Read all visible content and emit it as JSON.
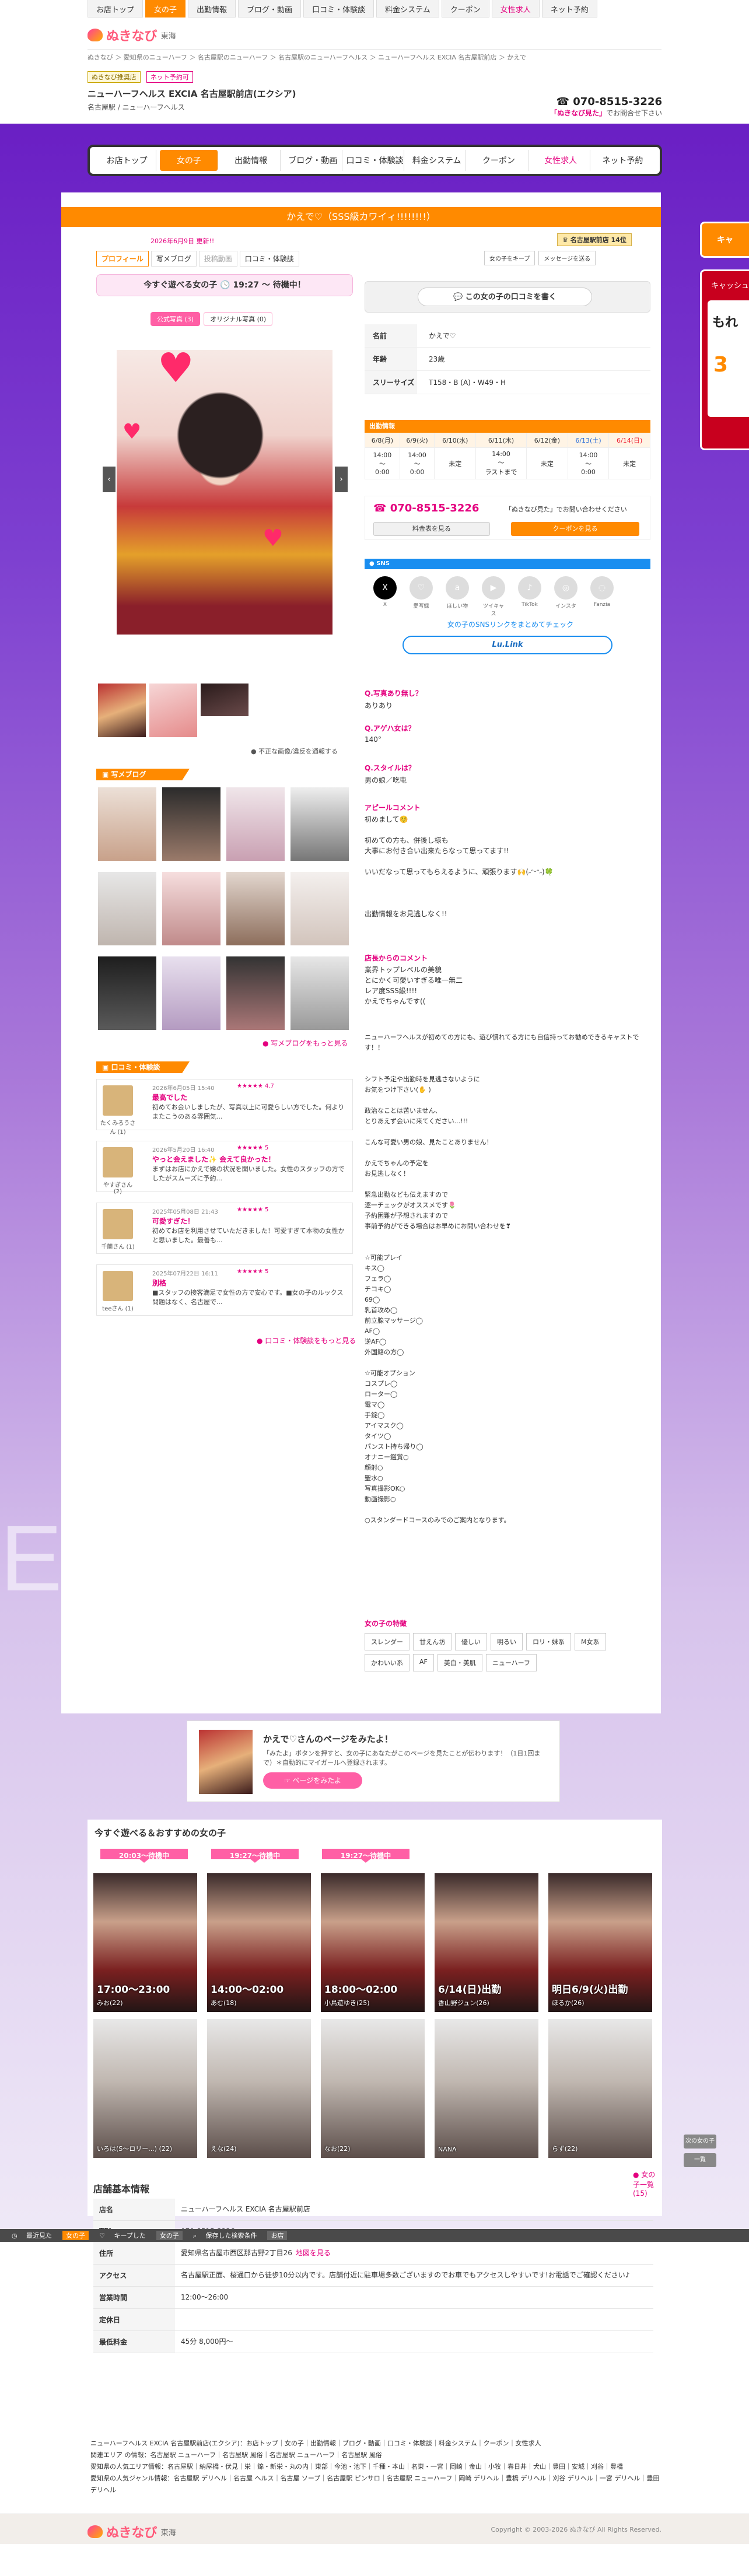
{
  "topnav": {
    "items": [
      "お店トップ",
      "女の子",
      "出勤情報",
      "ブログ・動画",
      "口コミ・体験談",
      "料金システム",
      "クーポン",
      "女性求人",
      "ネット予約"
    ],
    "active_index": 1
  },
  "logo": {
    "word": "ぬきなび",
    "area": "東海"
  },
  "breadcrumb": "ぬきなび ＞ 愛知県のニューハーフ ＞ 名古屋駅のニューハーフ ＞ 名古屋駅のニューハーフヘルス ＞ ニューハーフヘルス EXCIA 名古屋駅前店 ＞ かえで",
  "shop": {
    "tags": [
      "ぬきなび推奨店",
      "ネット予約可"
    ],
    "name": "ニューハーフヘルス EXCIA 名古屋駅前店(エクシア)",
    "sub": "名古屋駅 / ニューハーフヘルス",
    "tel": "070-8515-3226",
    "tel_note_pink": "「ぬきなび見た」",
    "tel_note": "でお問合せ下さい"
  },
  "mainnav": {
    "items": [
      "お店トップ",
      "女の子",
      "出勤情報",
      "ブログ・動画",
      "口コミ・体験談",
      "料金システム",
      "クーポン",
      "女性求人",
      "ネット予約"
    ]
  },
  "side": {
    "cast_btn": "キャ",
    "ad_top": "キャッシュ",
    "ad_mid": "もれ",
    "ad_num": "3"
  },
  "girl": {
    "title": "かえで♡（SSS級カワイィ!!!!!!!!）",
    "update_date": "2026年6月9日 更新!!",
    "rank_badge": "名古屋駅前店 14位",
    "tabs": [
      "プロフィール",
      "写メブログ",
      "投稿動画",
      "口コミ・体験談"
    ],
    "action_btns": [
      "女の子をキープ",
      "メッセージを送る"
    ],
    "available": "今すぐ遊べる女の子 🕓 19:27 〜 待機中！",
    "photo_tabs": [
      "公式写真 (3)",
      "オリジナル写真 (0)"
    ],
    "photo_note": "不正な画像/違反を通報する",
    "review_btn": "この女の子の口コミを書く",
    "profile": [
      {
        "k": "名前",
        "v": "かえで♡"
      },
      {
        "k": "年齢",
        "v": "23歳"
      },
      {
        "k": "スリーサイズ",
        "v": "T158・B (A)・W49・H"
      }
    ],
    "schedule": {
      "header": "出勤情報",
      "days": [
        "6/8(月)",
        "6/9(火)",
        "6/10(水)",
        "6/11(木)",
        "6/12(金)",
        "6/13(土)",
        "6/14(日)"
      ],
      "times": [
        "14:00\n〜\n0:00",
        "14:00\n〜\n0:00",
        "未定",
        "14:00\n〜\nラストまで",
        "未定",
        "14:00\n〜\n0:00",
        "未定"
      ]
    },
    "tel": "070-8515-3226",
    "tel_note": "「ぬきなび見た」でお問い合わせください",
    "price_btn": "料金表を見る",
    "coupon_btn": "クーポンを見る",
    "sns_header": "SNS",
    "sns": [
      {
        "icon": "X",
        "label": "X"
      },
      {
        "icon": "♡",
        "label": "愛写録"
      },
      {
        "icon": "a",
        "label": "ほしい物"
      },
      {
        "icon": "▶",
        "label": "ツイキャス"
      },
      {
        "icon": "♪",
        "label": "TikTok"
      },
      {
        "icon": "◎",
        "label": "インスタ"
      },
      {
        "icon": "◌",
        "label": "Fanzia"
      }
    ],
    "sns_link": "女の子のSNSリンクをまとめてチェック",
    "lulink": "Lu.Link",
    "qa": [
      {
        "q": "Q.写真あり無し？",
        "a": "ありあり"
      },
      {
        "q": "Q.アゲハ女は？",
        "a": "140°"
      },
      {
        "q": "Q.スタイルは？",
        "a": "男の娘／吃屯"
      }
    ],
    "appeal_title": "アピールコメント",
    "appeal": "初めまして☺️\n\n初めての方も、併後し様も\n大事にお付き合い出来たらなって思ってます!!\n\nいいだなって思ってもらえるように、頑張ります🙌(˶ᵔᵕᵔ˶)🍀\n\n\n\n出勤情報をお見逃しなく!!",
    "shop_comment_title": "店長からのコメント",
    "shop_comment": "業界トップレベルの美貌\nとにかく可愛いすぎる唯一無二\nレア度SSS級!!!!\nかえでちゃんです((",
    "long_text": "ニューハーフヘルスが初めての方にも、遊び慣れてる方にも自信持ってお勧めできるキャストです！！\n\n\nシフト予定や出勤時を見逃さないように\nお気をつけ下さい(✋ )\n\n政治なことは苦いません、\nとりあえず会いに来てください...!!!\n\nこんな可愛い男の娘、見たことありません！\n\nかえでちゃんの予定を\nお見逃しなく！\n\n緊急出勤なども伝えますので\n逐一チェックがオススメです🌷\n予約困難が予想されますので\n事前予約ができる場合はお早めにお問い合わせを❣\n\n\n☆可能プレイ\nキス◯\nフェラ◯\nチコキ◯\n69◯\n乳首攻め◯\n前立腺マッサージ◯\nAF◯\n逆AF◯\n外国籍の方◯\n\n☆可能オプション\nコスプレ◯\nローター◯\n電マ◯\n手錠◯\nアイマスク◯\nタイツ◯\nパンスト持ち帰り◯\nオナニー鑑賞○\n顔射○\n聖水○\n写真撮影OK○\n動画撮影○\n\n○スタンダードコースのみでのご案内となります。",
    "features_title": "女の子の特徴",
    "features": [
      "スレンダー",
      "甘えん坊",
      "優しい",
      "明るい",
      "ロリ・妹系",
      "M女系",
      "かわいい系",
      "AF",
      "美白・美肌",
      "ニューハーフ"
    ],
    "blog_title": "写メブログ",
    "blog_more": "写メブログをもっと見る",
    "review_section": "口コミ・体験談",
    "reviews": [
      {
        "name": "たくみろうさん (1)",
        "date": "2026年6月05日 15:40",
        "stars": "★★★★★ 4.7",
        "head": "最高でした",
        "body": "初めてお会いしましたが、写真以上に可愛らしい方でした。何よりまたこうのある雰囲気..."
      },
      {
        "name": "やすぎさん (2)",
        "date": "2026年5月20日 16:40",
        "stars": "★★★★★ 5",
        "head": "やっと会えました✨ 会えて良かった！",
        "body": "まずはお店にかえで嬢の状況を聞いました。女性のスタッフの方でしたがスムーズに予約..."
      },
      {
        "name": "千蘭さん (1)",
        "date": "2025年05月08日 21:43",
        "stars": "★★★★★ 5",
        "head": "可愛すぎた！",
        "body": "初めてお店を利用させていただきました！可愛すぎて本物の女性かと思いました。最善も..."
      },
      {
        "name": "teeさん (1)",
        "date": "2025年07月22日 16:11",
        "stars": "★★★★★ 5",
        "head": "別格",
        "body": "■スタッフの接客満足で女性の方で安心です。■女の子のルックス問題はなく、名古屋で..."
      }
    ],
    "review_more": "口コミ・体験談をもっと見る"
  },
  "mitane": {
    "title": "かえで♡さんのページをみたよ！",
    "desc": "「みたよ」ボタンを押すと、女の子にあなたがこのページを見たことが伝わります！（1日1回まで）＊自動的にマイガールへ登録されます。",
    "button": "ページをみたよ"
  },
  "recommend": {
    "title": "今すぐ遊べる＆おすすめの女の子",
    "badges": [
      "20:03〜待機中",
      "19:27〜待機中",
      "19:27〜待機中"
    ],
    "row1": [
      {
        "cap": "17:00〜23:00",
        "name": "みお(22)"
      },
      {
        "cap": "14:00〜02:00",
        "name": "あむ(18)"
      },
      {
        "cap": "18:00〜02:00",
        "name": "小鳥遊ゆき(25)"
      },
      {
        "cap": "6/14(日)出勤",
        "name": "香山野ジュン(26)"
      },
      {
        "cap": "明日6/9(火)出勤",
        "name": "ほるか(26)"
      }
    ],
    "row2": [
      {
        "name": "いろは(S〜ロリー...) (22)"
      },
      {
        "name": "えな(24)"
      },
      {
        "name": "なお(22)"
      },
      {
        "name": "NANA"
      },
      {
        "name": "らず(22)"
      }
    ],
    "more": "女の子一覧 (15)",
    "side_a": "次の女の子",
    "side_b": "一覧"
  },
  "bottombar": {
    "items": [
      "最近見た",
      "女の子",
      "キープした",
      "女の子",
      "保存した検索条件",
      "お店"
    ]
  },
  "store": {
    "title": "店舗基本情報",
    "rows": [
      {
        "k": "店名",
        "v": "ニューハーフヘルス EXCIA 名古屋駅前店"
      },
      {
        "k": "TEL",
        "v": "070-8515-3226"
      },
      {
        "k": "住所",
        "v": "愛知県名古屋市西区那古野2丁目26",
        "link": "地図を見る"
      },
      {
        "k": "アクセス",
        "v": "名古屋駅正面、桜通口から徒歩10分以内です。店舗付近に駐車場多数ございますのでお車でもアクセスしやすいです!お電話でご確認ください♪"
      },
      {
        "k": "営業時間",
        "v": "12:00〜26:00"
      },
      {
        "k": "定休日",
        "v": ""
      },
      {
        "k": "最低料金",
        "v": "45分 8,000円〜"
      }
    ]
  },
  "footer": {
    "line1": "ニューハーフヘルス EXCIA 名古屋駅前店(エクシア)：お店トップ｜女の子｜出勤情報｜ブログ・動画｜口コミ・体験談｜料金システム｜クーポン｜女性求人",
    "line2": "関連エリア の情報：名古屋駅 ニューハーフ｜名古屋駅 風俗｜名古屋駅 ニューハーフ｜名古屋駅 風俗",
    "line3": "愛知県の人気エリア情報：名古屋駅｜納屋橋・伏見｜栄｜錦・新栄・丸の内｜東部｜今池・池下｜千種・本山｜名東・一宮｜岡崎｜金山｜小牧｜春日井｜犬山｜豊田｜安城｜刈谷｜豊橋",
    "line4": "愛知県の人気ジャンル情報：名古屋駅 デリヘル｜名古屋 ヘルス｜名古屋 ソープ｜名古屋駅 ピンサロ｜名古屋駅 ニューハーフ｜岡崎 デリヘル｜豊橋 デリヘル｜刈谷 デリヘル｜一宮 デリヘル｜豊田 デリヘル",
    "copyright": "Copyright © 2003-2026 ぬきなび All Rights Reserved."
  }
}
